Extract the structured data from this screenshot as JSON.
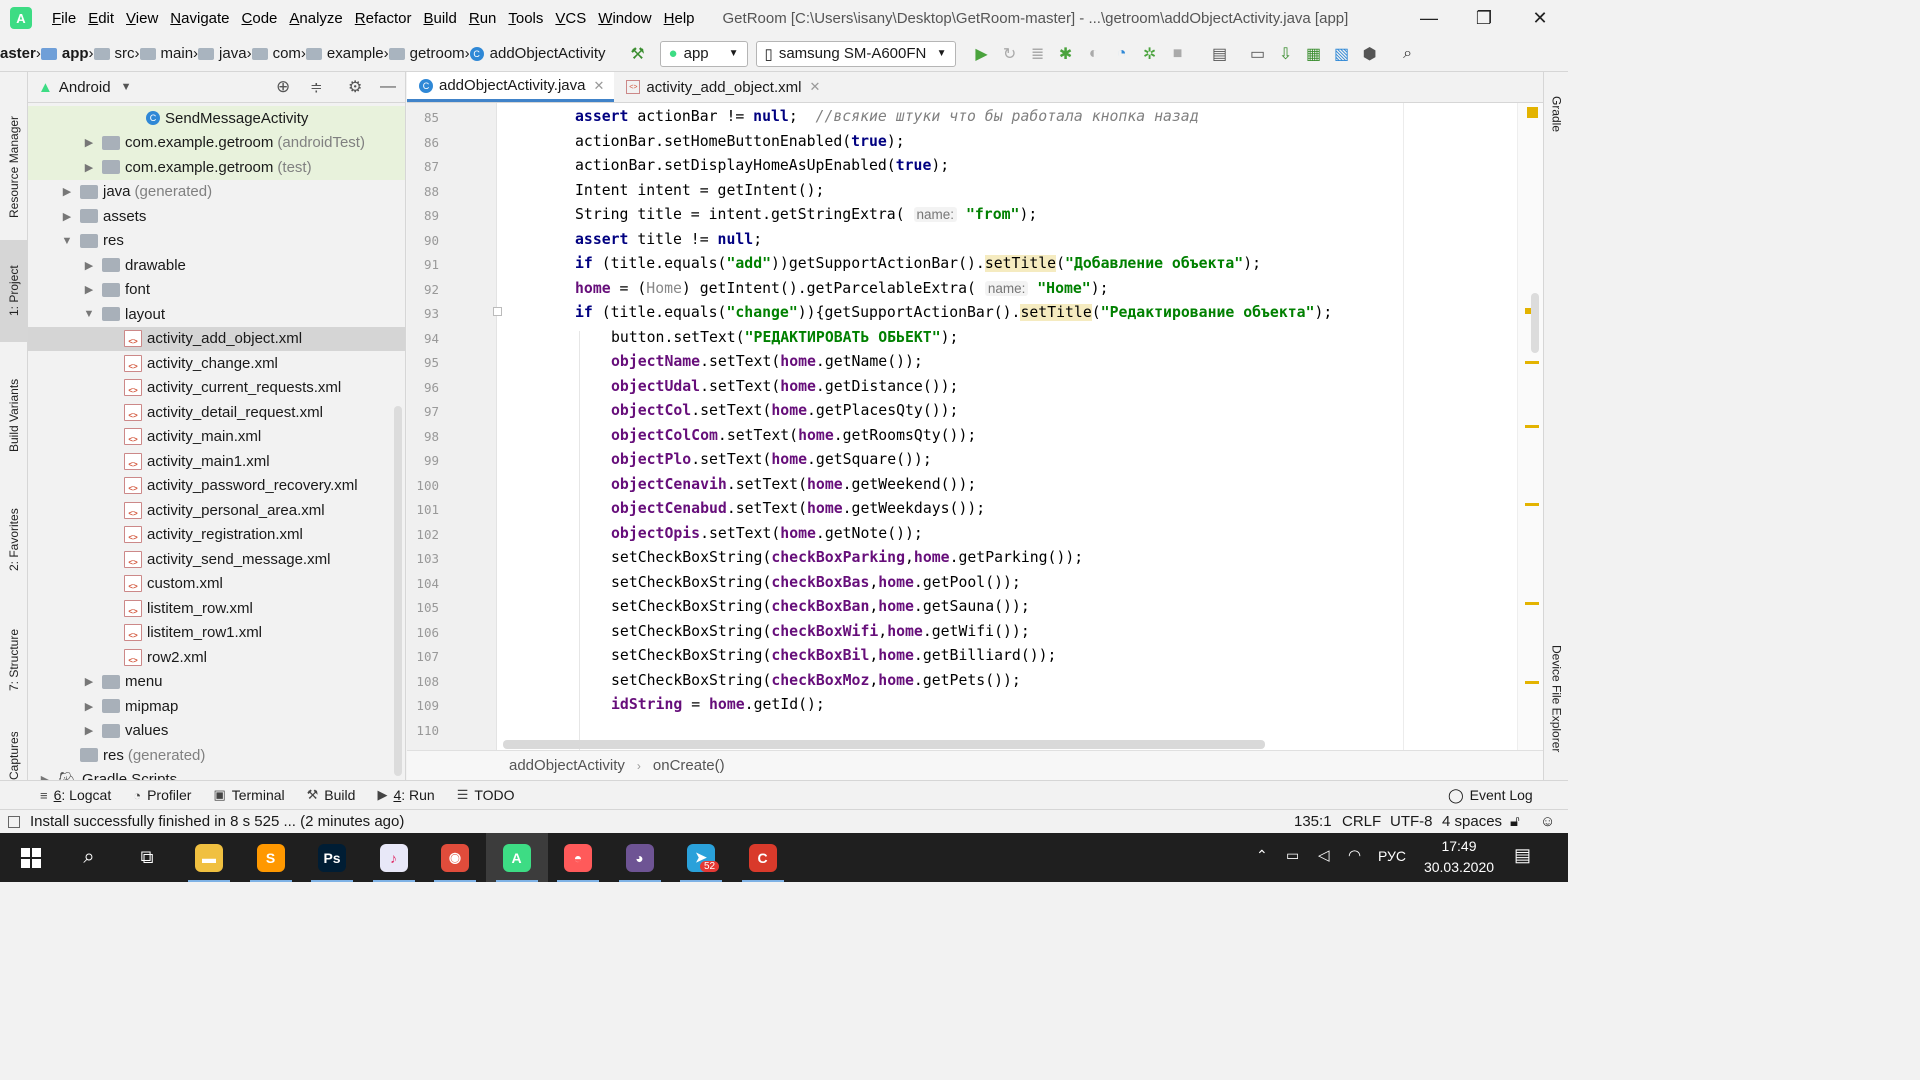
{
  "window": {
    "title": "GetRoom [C:\\Users\\isany\\Desktop\\GetRoom-master] - ...\\getroom\\addObjectActivity.java [app]",
    "minimize": "—",
    "restore": "❐",
    "close": "✕"
  },
  "menu": [
    "File",
    "Edit",
    "View",
    "Navigate",
    "Code",
    "Analyze",
    "Refactor",
    "Build",
    "Run",
    "Tools",
    "VCS",
    "Window",
    "Help"
  ],
  "nav": {
    "crumbs": [
      "aster",
      "app",
      "src",
      "main",
      "java",
      "com",
      "example",
      "getroom",
      "addObjectActivity"
    ],
    "run_config": "app",
    "device": "samsung SM-A600FN"
  },
  "project_panel": {
    "view_mode": "Android",
    "rows": [
      {
        "label": "SendMessageActivity",
        "secondary": "",
        "indent": 4,
        "icon": "class",
        "arrow": "",
        "selected": false,
        "bg": "#e8f2dc"
      },
      {
        "label": "com.example.getroom",
        "secondary": "(androidTest)",
        "indent": 2,
        "icon": "folder",
        "arrow": "▶",
        "selected": false,
        "bg": "#e8f2dc"
      },
      {
        "label": "com.example.getroom",
        "secondary": "(test)",
        "indent": 2,
        "icon": "folder",
        "arrow": "▶",
        "selected": false,
        "bg": "#e8f2dc"
      },
      {
        "label": "java",
        "secondary": "(generated)",
        "indent": 1,
        "icon": "folder",
        "arrow": "▶",
        "selected": false,
        "bg": ""
      },
      {
        "label": "assets",
        "secondary": "",
        "indent": 1,
        "icon": "folder",
        "arrow": "▶",
        "selected": false,
        "bg": ""
      },
      {
        "label": "res",
        "secondary": "",
        "indent": 1,
        "icon": "folder",
        "arrow": "▼",
        "selected": false,
        "bg": ""
      },
      {
        "label": "drawable",
        "secondary": "",
        "indent": 2,
        "icon": "folder",
        "arrow": "▶",
        "selected": false,
        "bg": ""
      },
      {
        "label": "font",
        "secondary": "",
        "indent": 2,
        "icon": "folder",
        "arrow": "▶",
        "selected": false,
        "bg": ""
      },
      {
        "label": "layout",
        "secondary": "",
        "indent": 2,
        "icon": "folder",
        "arrow": "▼",
        "selected": false,
        "bg": ""
      },
      {
        "label": "activity_add_object.xml",
        "secondary": "",
        "indent": 3,
        "icon": "xml",
        "arrow": "",
        "selected": true,
        "bg": "#d5d5d5"
      },
      {
        "label": "activity_change.xml",
        "secondary": "",
        "indent": 3,
        "icon": "xml",
        "arrow": "",
        "selected": false,
        "bg": ""
      },
      {
        "label": "activity_current_requests.xml",
        "secondary": "",
        "indent": 3,
        "icon": "xml",
        "arrow": "",
        "selected": false,
        "bg": ""
      },
      {
        "label": "activity_detail_request.xml",
        "secondary": "",
        "indent": 3,
        "icon": "xml",
        "arrow": "",
        "selected": false,
        "bg": ""
      },
      {
        "label": "activity_main.xml",
        "secondary": "",
        "indent": 3,
        "icon": "xml",
        "arrow": "",
        "selected": false,
        "bg": ""
      },
      {
        "label": "activity_main1.xml",
        "secondary": "",
        "indent": 3,
        "icon": "xml",
        "arrow": "",
        "selected": false,
        "bg": ""
      },
      {
        "label": "activity_password_recovery.xml",
        "secondary": "",
        "indent": 3,
        "icon": "xml",
        "arrow": "",
        "selected": false,
        "bg": ""
      },
      {
        "label": "activity_personal_area.xml",
        "secondary": "",
        "indent": 3,
        "icon": "xml",
        "arrow": "",
        "selected": false,
        "bg": ""
      },
      {
        "label": "activity_registration.xml",
        "secondary": "",
        "indent": 3,
        "icon": "xml",
        "arrow": "",
        "selected": false,
        "bg": ""
      },
      {
        "label": "activity_send_message.xml",
        "secondary": "",
        "indent": 3,
        "icon": "xml",
        "arrow": "",
        "selected": false,
        "bg": ""
      },
      {
        "label": "custom.xml",
        "secondary": "",
        "indent": 3,
        "icon": "xml",
        "arrow": "",
        "selected": false,
        "bg": ""
      },
      {
        "label": "listitem_row.xml",
        "secondary": "",
        "indent": 3,
        "icon": "xml",
        "arrow": "",
        "selected": false,
        "bg": ""
      },
      {
        "label": "listitem_row1.xml",
        "secondary": "",
        "indent": 3,
        "icon": "xml",
        "arrow": "",
        "selected": false,
        "bg": ""
      },
      {
        "label": "row2.xml",
        "secondary": "",
        "indent": 3,
        "icon": "xml",
        "arrow": "",
        "selected": false,
        "bg": ""
      },
      {
        "label": "menu",
        "secondary": "",
        "indent": 2,
        "icon": "folder",
        "arrow": "▶",
        "selected": false,
        "bg": ""
      },
      {
        "label": "mipmap",
        "secondary": "",
        "indent": 2,
        "icon": "folder",
        "arrow": "▶",
        "selected": false,
        "bg": ""
      },
      {
        "label": "values",
        "secondary": "",
        "indent": 2,
        "icon": "folder",
        "arrow": "▶",
        "selected": false,
        "bg": ""
      },
      {
        "label": "res",
        "secondary": "(generated)",
        "indent": 1,
        "icon": "folder",
        "arrow": "",
        "selected": false,
        "bg": ""
      },
      {
        "label": "Gradle Scripts",
        "secondary": "",
        "indent": 0,
        "icon": "gradle",
        "arrow": "▶",
        "selected": false,
        "bg": ""
      }
    ]
  },
  "editor": {
    "tabs": [
      {
        "label": "addObjectActivity.java",
        "active": true
      },
      {
        "label": "activity_add_object.xml",
        "active": false
      }
    ],
    "lines": [
      {
        "n": "85",
        "indent": 0,
        "html": "<span class=\"kw\">assert</span> actionBar != <span class=\"kw\">null</span>;  <span class=\"cmt\">//всякие штуки что бы работала кнопка назад</span>"
      },
      {
        "n": "86",
        "indent": 0,
        "html": "actionBar.setHomeButtonEnabled(<span class=\"kw\">true</span>);"
      },
      {
        "n": "87",
        "indent": 0,
        "html": "actionBar.setDisplayHomeAsUpEnabled(<span class=\"kw\">true</span>);"
      },
      {
        "n": "88",
        "indent": 0,
        "html": "Intent intent = getIntent();"
      },
      {
        "n": "89",
        "indent": 0,
        "html": "String title = intent.getStringExtra( <span class=\"hint\">name:</span> <span class=\"str\">\"from\"</span>);"
      },
      {
        "n": "90",
        "indent": 0,
        "html": "<span class=\"kw\">assert</span> title != <span class=\"kw\">null</span>;"
      },
      {
        "n": "91",
        "indent": 0,
        "html": "<span class=\"kw\">if</span> (title.equals(<span class=\"str\">\"add\"</span>))getSupportActionBar().<span class=\"hl\">setTitle</span>(<span class=\"str\">\"Добавление объекта\"</span>);"
      },
      {
        "n": "92",
        "indent": 0,
        "html": "<span class=\"fld\">home</span> = (<span class=\"greyt\">Home</span>) getIntent().getParcelableExtra( <span class=\"hint\">name:</span> <span class=\"str\">\"Home\"</span>);"
      },
      {
        "n": "93",
        "indent": 0,
        "html": "<span class=\"kw\">if</span> (title.equals(<span class=\"str\">\"change\"</span>)){getSupportActionBar().<span class=\"hl\">setTitle</span>(<span class=\"str\">\"Редактирование объекта\"</span>);"
      },
      {
        "n": "94",
        "indent": 1,
        "html": "button.setText(<span class=\"str\">\"РЕДАКТИРОВАТЬ ОБЬЕКТ\"</span>);"
      },
      {
        "n": "95",
        "indent": 1,
        "html": "<span class=\"fld\">objectName</span>.setText(<span class=\"fld\">home</span>.getName());"
      },
      {
        "n": "96",
        "indent": 1,
        "html": "<span class=\"fld\">objectUdal</span>.setText(<span class=\"fld\">home</span>.getDistance());"
      },
      {
        "n": "97",
        "indent": 1,
        "html": "<span class=\"fld\">objectCol</span>.setText(<span class=\"fld\">home</span>.getPlacesQty());"
      },
      {
        "n": "98",
        "indent": 1,
        "html": "<span class=\"fld\">objectColCom</span>.setText(<span class=\"fld\">home</span>.getRoomsQty());"
      },
      {
        "n": "99",
        "indent": 1,
        "html": "<span class=\"fld\">objectPlo</span>.setText(<span class=\"fld\">home</span>.getSquare());"
      },
      {
        "n": "100",
        "indent": 1,
        "html": "<span class=\"fld\">objectCenavih</span>.setText(<span class=\"fld\">home</span>.getWeekend());"
      },
      {
        "n": "101",
        "indent": 1,
        "html": "<span class=\"fld\">objectCenabud</span>.setText(<span class=\"fld\">home</span>.getWeekdays());"
      },
      {
        "n": "102",
        "indent": 1,
        "html": "<span class=\"fld\">objectOpis</span>.setText(<span class=\"fld\">home</span>.getNote());"
      },
      {
        "n": "103",
        "indent": 1,
        "html": "setCheckBoxString(<span class=\"fld\">checkBoxParking</span>,<span class=\"fld\">home</span>.getParking());"
      },
      {
        "n": "104",
        "indent": 1,
        "html": "setCheckBoxString(<span class=\"fld\">checkBoxBas</span>,<span class=\"fld\">home</span>.getPool());"
      },
      {
        "n": "105",
        "indent": 1,
        "html": "setCheckBoxString(<span class=\"fld\">checkBoxBan</span>,<span class=\"fld\">home</span>.getSauna());"
      },
      {
        "n": "106",
        "indent": 1,
        "html": "setCheckBoxString(<span class=\"fld\">checkBoxWifi</span>,<span class=\"fld\">home</span>.getWifi());"
      },
      {
        "n": "107",
        "indent": 1,
        "html": "setCheckBoxString(<span class=\"fld\">checkBoxBil</span>,<span class=\"fld\">home</span>.getBilliard());"
      },
      {
        "n": "108",
        "indent": 1,
        "html": "setCheckBoxString(<span class=\"fld\">checkBoxMoz</span>,<span class=\"fld\">home</span>.getPets());"
      },
      {
        "n": "109",
        "indent": 1,
        "html": "<span class=\"fld\">idString</span> = <span class=\"fld\">home</span>.getId();"
      },
      {
        "n": "110",
        "indent": 0,
        "html": ""
      }
    ],
    "breadcrumb": [
      "addObjectActivity",
      "onCreate()"
    ]
  },
  "left_strip": [
    "Resource Manager",
    "1: Project",
    "Build Variants",
    "2: Favorites",
    "7: Structure",
    "Captures"
  ],
  "right_strip": [
    "Gradle",
    "Device File Explorer"
  ],
  "bottom_tools": [
    {
      "key": "6",
      "label": ": Logcat",
      "icon": "≡"
    },
    {
      "key": "",
      "label": "Profiler",
      "icon": "◔"
    },
    {
      "key": "",
      "label": "Terminal",
      "icon": "▣"
    },
    {
      "key": "",
      "label": "Build",
      "icon": "⚒"
    },
    {
      "key": "4",
      "label": ": Run",
      "icon": "▶"
    },
    {
      "key": "",
      "label": "TODO",
      "icon": "☰"
    }
  ],
  "event_log": "Event Log",
  "status": {
    "message": "Install successfully finished in 8 s 525 ... (2 minutes ago)",
    "position": "135:1",
    "line_sep": "CRLF",
    "encoding": "UTF-8",
    "indent": "4 spaces"
  },
  "taskbar": {
    "apps": [
      {
        "name": "file-explorer",
        "color": "#f0c040",
        "glyph": "▬"
      },
      {
        "name": "sublime-text",
        "color": "#ff9800",
        "glyph": "S"
      },
      {
        "name": "photoshop",
        "color": "#001d34",
        "glyph": "Ps"
      },
      {
        "name": "itunes",
        "color": "#e8e8f8",
        "glyph": "♪"
      },
      {
        "name": "chrome",
        "color": "#e04c3b",
        "glyph": "◉"
      },
      {
        "name": "android-studio",
        "color": "#3ddc84",
        "glyph": "A"
      },
      {
        "name": "lgbt-app",
        "color": "#ff5a5a",
        "glyph": "◓"
      },
      {
        "name": "github",
        "color": "#6e5494",
        "glyph": "◕"
      },
      {
        "name": "telegram",
        "color": "#2aa1da",
        "glyph": "➤"
      },
      {
        "name": "ccleaner",
        "color": "#d93a2b",
        "glyph": "C"
      }
    ],
    "telegram_badge": "52",
    "lang": "РУС",
    "time": "17:49",
    "date": "30.03.2020"
  }
}
